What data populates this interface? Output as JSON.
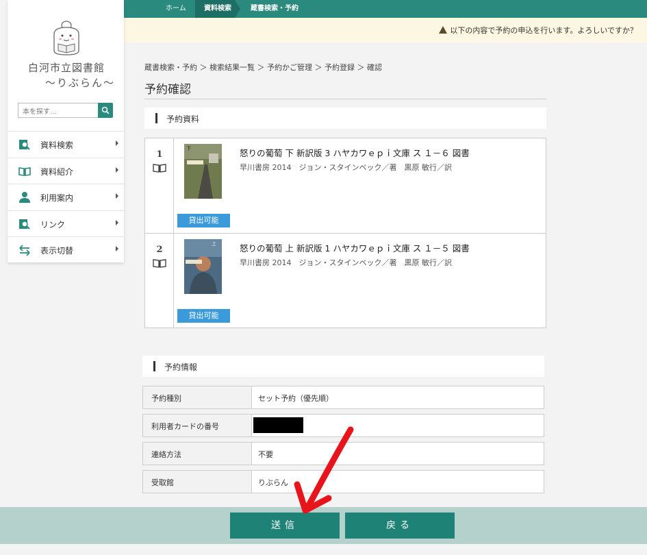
{
  "topnav": {
    "home": "ホーム",
    "search": "資料検索",
    "current": "蔵書検索・予約"
  },
  "notice": {
    "text": "以下の内容で予約の申込を行います。よろしいですか？"
  },
  "sidebar": {
    "library_name": "白河市立図書館",
    "library_sub": "～りぶらん～",
    "search_placeholder": "本を探す…",
    "items": [
      {
        "label": "資料検索",
        "icon": "search-doc-icon"
      },
      {
        "label": "資料紹介",
        "icon": "open-book-icon"
      },
      {
        "label": "利用案内",
        "icon": "person-icon"
      },
      {
        "label": "リンク",
        "icon": "search-doc-icon"
      },
      {
        "label": "表示切替",
        "icon": "swap-arrows-icon"
      }
    ]
  },
  "breadcrumb": "蔵書検索・予約 ＞ 検索結果一覧 ＞ 予約かご管理 ＞ 予約登録 ＞ 確認",
  "page_title": "予約確認",
  "materials": {
    "heading": "予約資料",
    "items": [
      {
        "num": "1",
        "title": "怒りの葡萄 下 新訳版 3 ハヤカワｅｐｉ文庫 ス １－６ 図書",
        "meta": "早川書房 2014　ジョン・スタインベック／著　黒原 敏行／訳",
        "status": "貸出可能"
      },
      {
        "num": "2",
        "title": "怒りの葡萄 上 新訳版 1 ハヤカワｅｐｉ文庫 ス １－５ 図書",
        "meta": "早川書房 2014　ジョン・スタインベック／著　黒原 敏行／訳",
        "status": "貸出可能"
      }
    ]
  },
  "reservation": {
    "heading": "予約情報",
    "rows": [
      {
        "key": "予約種別",
        "value": "セット予約（優先順）"
      },
      {
        "key": "利用者カードの番号",
        "value": ""
      },
      {
        "key": "連絡方法",
        "value": "不要"
      },
      {
        "key": "受取館",
        "value": "りぶらん"
      }
    ]
  },
  "footer": {
    "submit": "送信",
    "back": "戻る"
  },
  "colors": {
    "accent": "#2a8a7e",
    "available": "#3b9ad9",
    "annotation": "#e8141c"
  }
}
